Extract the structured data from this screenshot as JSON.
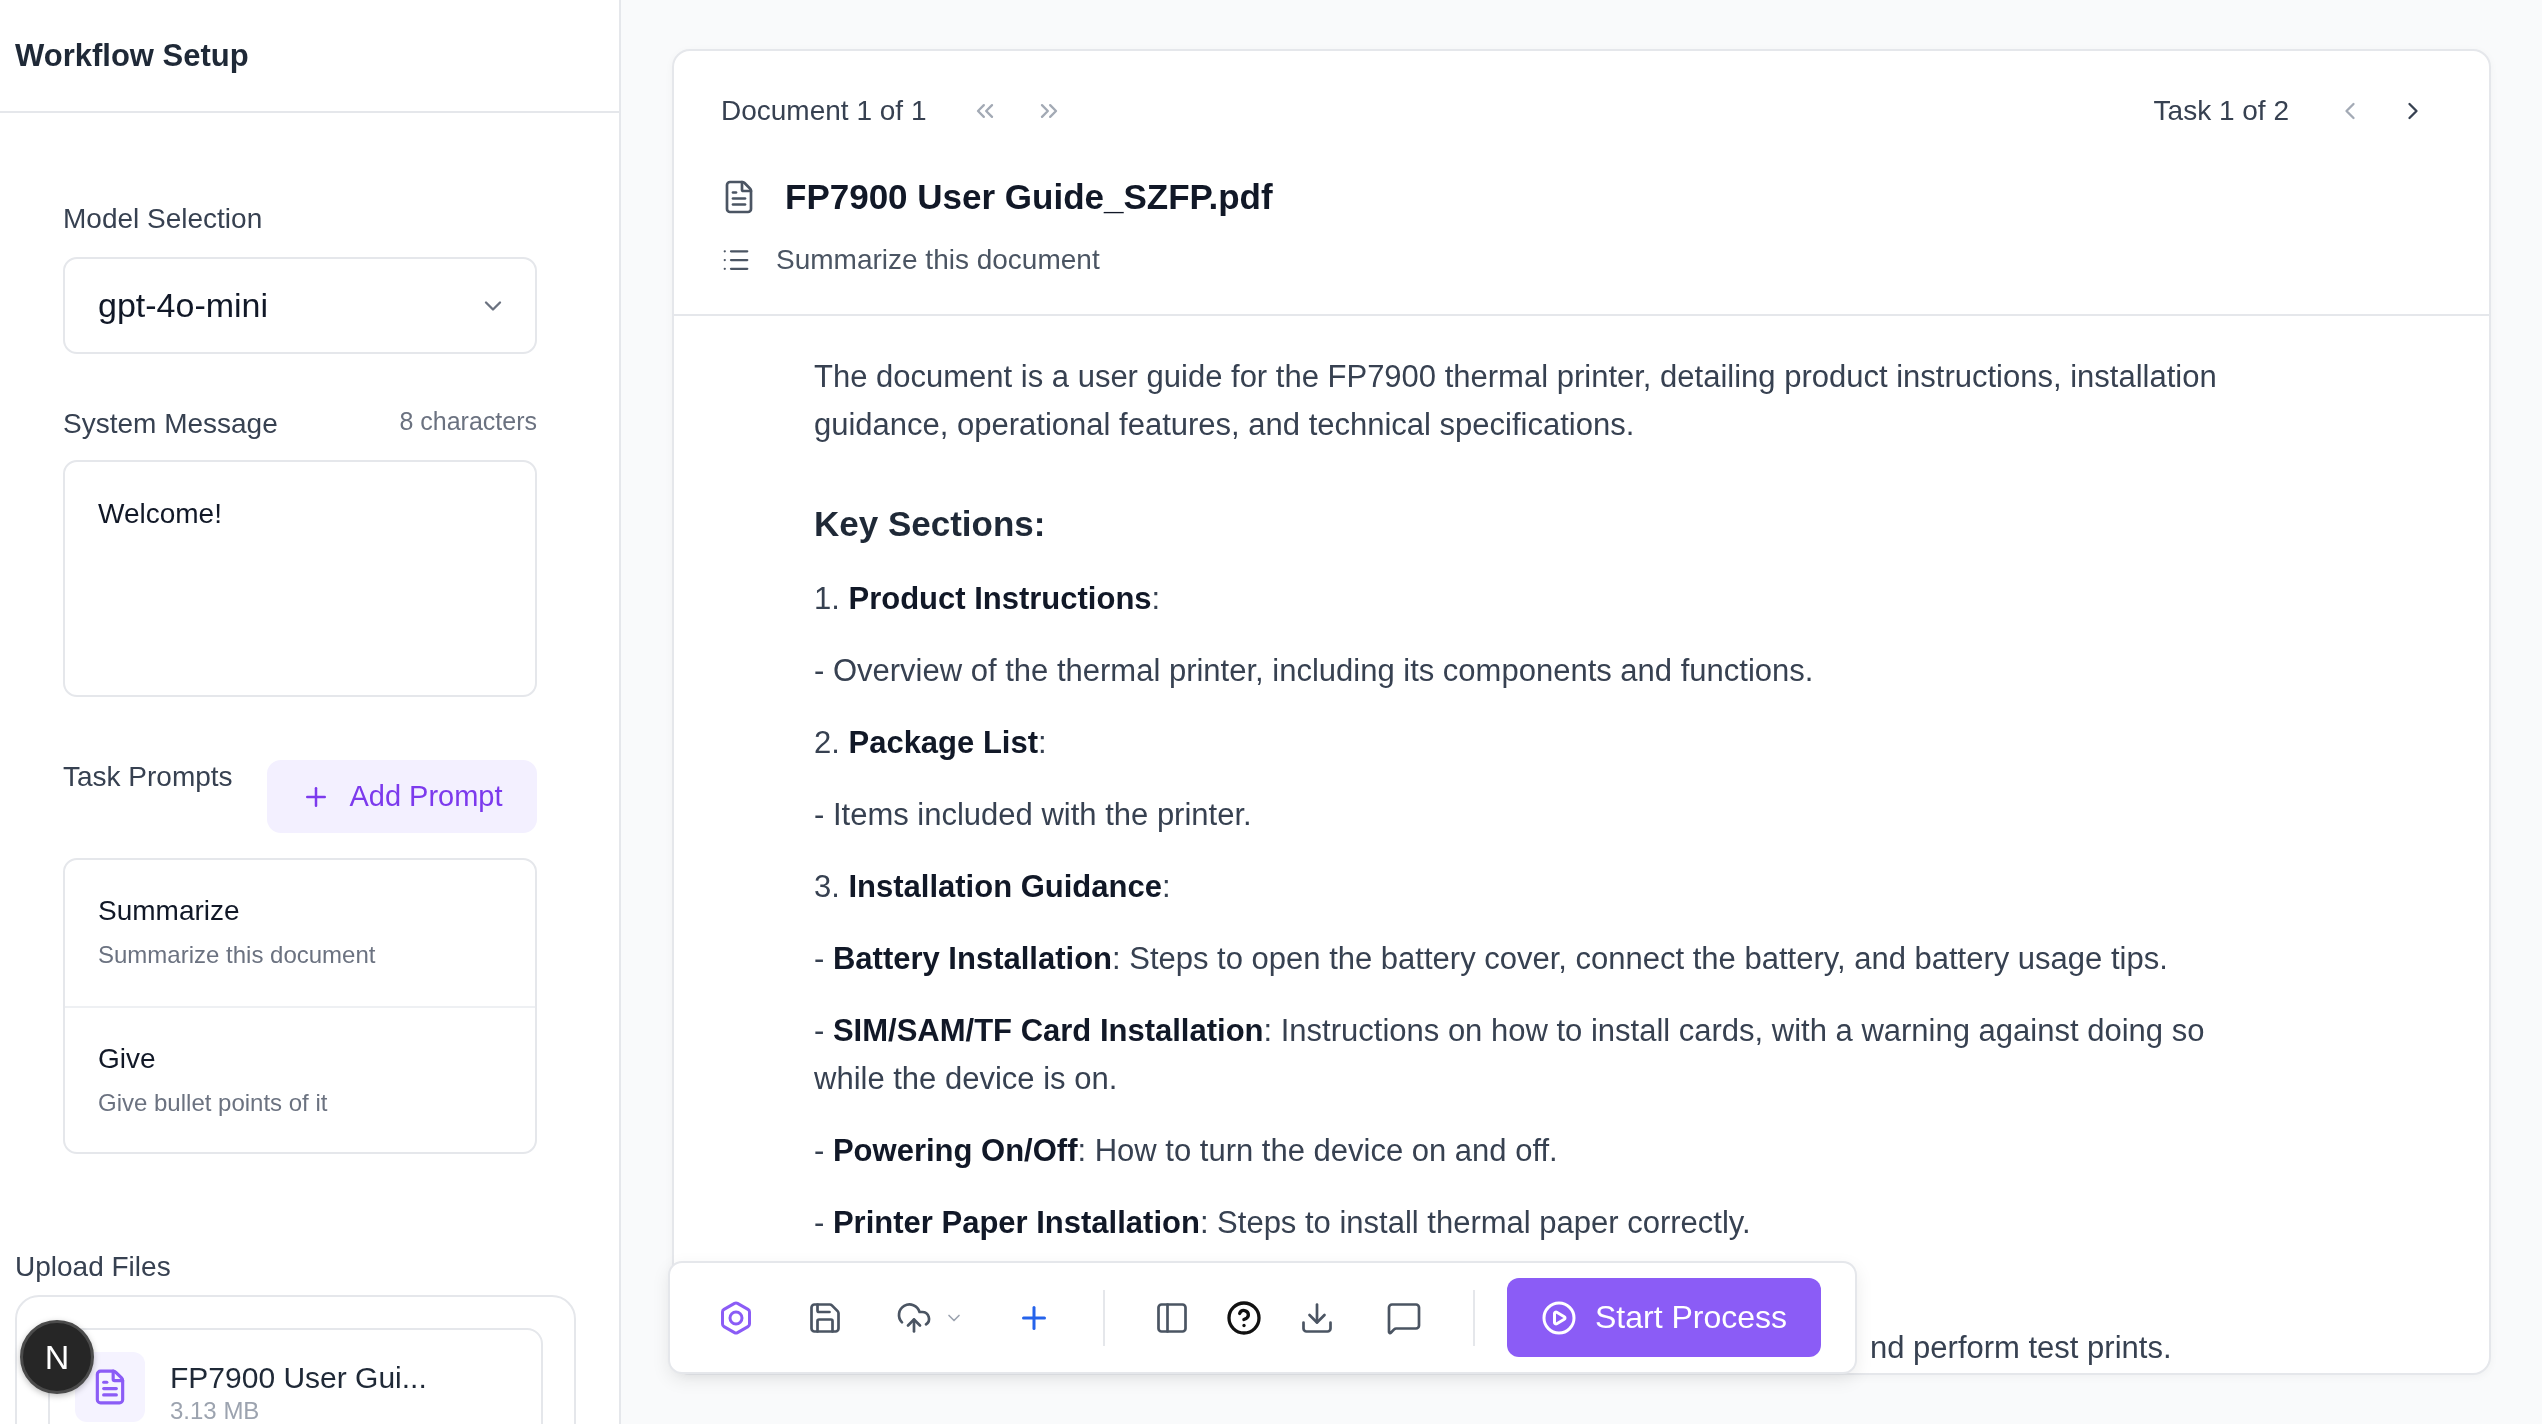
{
  "sidebar": {
    "title": "Workflow Setup",
    "model_selection": {
      "label": "Model Selection",
      "value": "gpt-4o-mini"
    },
    "system_message": {
      "label": "System Message",
      "count": "8 characters",
      "value": "Welcome!"
    },
    "task_prompts": {
      "label": "Task Prompts",
      "add_button": "Add Prompt",
      "items": [
        {
          "title": "Summarize",
          "description": "Summarize this document"
        },
        {
          "title": "Give",
          "description": "Give bullet points of it"
        }
      ]
    },
    "upload_files": {
      "label": "Upload Files",
      "files": [
        {
          "name": "FP7900 User Gui...",
          "size": "3.13 MB"
        }
      ]
    },
    "avatar": {
      "initial": "N"
    }
  },
  "document_panel": {
    "document_nav": {
      "label": "Document 1 of 1",
      "prev_disabled": true,
      "next_disabled": true
    },
    "task_nav": {
      "label": "Task 1 of 2",
      "prev_disabled": true,
      "next_disabled": false
    },
    "file_name": "FP7900 User Guide_SZFP.pdf",
    "prompt": "Summarize this document",
    "result": [
      {
        "kind": "paragraph",
        "text": "The document is a user guide for the FP7900 thermal printer, detailing product instructions, installation guidance, operational features, and technical specifications."
      },
      {
        "kind": "heading",
        "text": "Key Sections:"
      },
      {
        "kind": "paragraph",
        "text": "1. **Product Instructions**:"
      },
      {
        "kind": "paragraph",
        "text": "- Overview of the thermal printer, including its components and functions."
      },
      {
        "kind": "paragraph",
        "text": "2. **Package List**:"
      },
      {
        "kind": "paragraph",
        "text": "- Items included with the printer."
      },
      {
        "kind": "paragraph",
        "text": "3. **Installation Guidance**:"
      },
      {
        "kind": "paragraph",
        "text": "- **Battery Installation**: Steps to open the battery cover, connect the battery, and battery usage tips."
      },
      {
        "kind": "paragraph",
        "text": "- **SIM/SAM/TF Card Installation**: Instructions on how to install cards, with a warning against doing so while the device is on."
      },
      {
        "kind": "paragraph",
        "text": "- **Powering On/Off**: How to turn the device on and off."
      },
      {
        "kind": "paragraph",
        "text": "- **Printer Paper Installation**: Steps to install thermal paper correctly."
      },
      {
        "kind": "fragment",
        "text": "nd perform test prints."
      }
    ]
  },
  "toolbar": {
    "start_button": "Start Process"
  }
}
